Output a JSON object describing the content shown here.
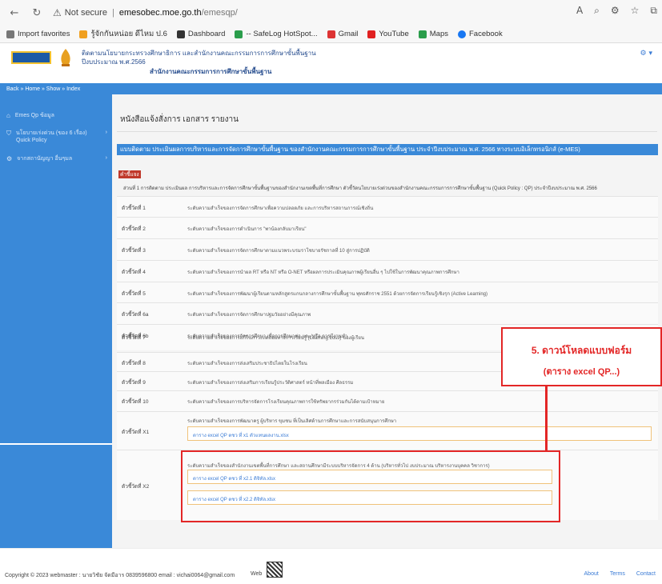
{
  "browser": {
    "security_label": "Not secure",
    "url_host": "emesobec.moe.go.th",
    "url_path": "/emesqp/",
    "bookmarks": [
      {
        "label": "Import favorites",
        "color": "#777"
      },
      {
        "label": "รู้จักกันหน่อย ดีไหม ป.6",
        "color": "#f0a020"
      },
      {
        "label": "Dashboard",
        "color": "#333"
      },
      {
        "label": "-- SafeLog HotSpot...",
        "color": "#2a9d4b"
      },
      {
        "label": "Gmail",
        "color": "#d33"
      },
      {
        "label": "YouTube",
        "color": "#e02020"
      },
      {
        "label": "Maps",
        "color": "#2a9d4b"
      },
      {
        "label": "Facebook",
        "color": "#1877f2"
      }
    ]
  },
  "site": {
    "header_line1": "ติดตามนโยบายกระทรวงศึกษาธิการ และสำนักงานคณะกรรมการการศึกษาขั้นพื้นฐาน",
    "header_line2": "ปีงบประมาณ พ.ศ.2566",
    "header_line3": "สำนักงานคณะกรรมการการศึกษาขั้นพื้นฐาน"
  },
  "breadcrumb": "Back » Home » Show » Index",
  "sidebar": {
    "items": [
      {
        "icon": "△",
        "label": "Emes Qp ข้อมูล"
      },
      {
        "icon": "▽",
        "label": "นโยบายเร่งด่วน (ของ 6 เรื่อง) Quick Policy"
      },
      {
        "icon": "◎",
        "label": "จากสถานัญญา อื่นๆมล"
      }
    ]
  },
  "page": {
    "title": "หนังสือแจ้งสั่งการ เอกสาร รายงาน",
    "banner": "แบบติดตาม ประเมินผลการบริหารและการจัดการศึกษาขั้นพื้นฐาน ของสำนักงานคณะกรรมการการศึกษาขั้นพื้นฐาน ประจำปีงบประมาณ พ.ศ. 2566 ทางระบบอิเล็กทรอนิกส์ (e-MES)",
    "section_tag": "คำชี้แจง",
    "intro": "ส่วนที่ 1 การติดตาม ประเมินผล การบริหารและการจัดการศึกษาขั้นพื้นฐานของสำนักงานเขตพื้นที่การศึกษา ตัวชี้วัดนโยบายเร่งด่วนของสำนักงานคณะกรรมการการศึกษาขั้นพื้นฐาน (Quick Policy : QP) ประจำปีงบประมาณ พ.ศ. 2566",
    "rows": [
      {
        "key": "ตัวชี้วัดที่ 1",
        "value": "ระดับความสำเร็จของการจัดการศึกษาเพื่อความปลอดภัย และการบริหารสถานการณ์เชิงถิ่น"
      },
      {
        "key": "ตัวชี้วัดที่ 2",
        "value": "ระดับความสำเร็จของการดำเนินการ \"พาน้องกลับมาเรียน\""
      },
      {
        "key": "ตัวชี้วัดที่ 3",
        "value": "ระดับความสำเร็จของการจัดการศึกษาตามแนวพระบรมราโชบายรัชกาลที่ 10 สู่การปฏิบัติ"
      },
      {
        "key": "ตัวชี้วัดที่ 4",
        "value": "ระดับความสำเร็จของการนำผล RT หรือ NT หรือ O-NET หรือผลการประเมินคุณภาพผู้เรียนอื่น ๆ ไปใช้ในการพัฒนาคุณภาพการศึกษา"
      },
      {
        "key": "ตัวชี้วัดที่ 5",
        "value": "ระดับความสำเร็จของการพัฒนาผู้เรียนตามหลักสูตรแกนกลางการศึกษาขั้นพื้นฐาน พุทธศักราช 2551 ด้วยการจัดการเรียนรู้เชิงรุก (Active Learning)"
      },
      {
        "key": "ตัวชี้วัดที่ 6a",
        "value": "ระดับความสำเร็จของการจัดการศึกษาปฐมวัยอย่างมีคุณภาพ"
      },
      {
        "key": "ตัวชี้วัดที่ 6b",
        "value": "ระดับความสำเร็จของการจัดการศึกษา เพื่อการศึกษาต่อ และ/หรือ การมีงานทำ"
      },
      {
        "key": "ตัวชี้วัดที่ 7",
        "value": "ระดับความสำเร็จของการแก้ไขภาวะถดถอยทางการเรียนรู้ (Learning Loss) ของผู้เรียน"
      },
      {
        "key": "ตัวชี้วัดที่ 8",
        "value": "ระดับความสำเร็จของการส่งเสริมประชาธิปไตยในโรงเรียน"
      },
      {
        "key": "ตัวชี้วัดที่ 9",
        "value": "ระดับความสำเร็จของการส่งเสริมการเรียนรู้ประวัติศาสตร์ หน้าที่พลเมือง ศีลธรรม"
      },
      {
        "key": "ตัวชี้วัดที่ 10",
        "value": "ระดับความสำเร็จของการบริหารจัดการโรงเรียนคุณภาพการใช้ทรัพยากรร่วมกันได้ตามเป้าหมาย"
      }
    ],
    "x1": {
      "key": "ตัวชี้วัดที่ X1",
      "value": "ระดับความสำเร็จของการพัฒนาครู ผู้บริหาร ขุมชน ที่เป็นเลิศด้านการศึกษาและการสนับสนุนการศึกษา",
      "link": "ตาราง excel QP ตชว ที่ x1 ตัวแทนผลงาน.xlsx"
    },
    "x2": {
      "key": "ตัวชี้วัดที่ X2",
      "value": "ระดับความสำเร็จของสำนักงานเขตพื้นที่การศึกษา และสถานศึกษามีระบบบริหารจัดการ 4 ด้าน (บริหารทั่วไป งบประมาณ บริหารงานบุคคล วิชาการ)",
      "link1": "ตาราง excel QP ตชว ที่ x2.1 ดิจิทัล.xlsx",
      "link2": "ตาราง excel QP ตชว ที่ x2.2 ดิจิทัล.xlsx"
    }
  },
  "annotation": {
    "line1": "5. ดาวน์โหลดแบบฟอร์ม",
    "line2": "(ตาราง excel QP...)",
    "color": "#e32626"
  },
  "footer": {
    "copyright": "Copyright © 2023 webmaster : นายวิชัย จัดมีอาร 0839596800 email : vichai0064@gmail.com",
    "web": "Web",
    "links": [
      "About",
      "Terms",
      "Contact"
    ]
  }
}
